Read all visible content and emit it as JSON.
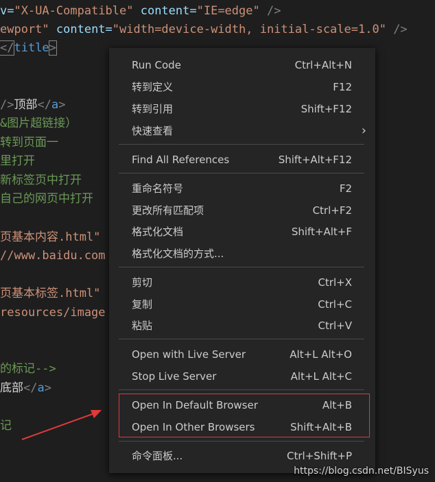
{
  "editor": {
    "line1": {
      "attr": "v=",
      "value": "\"X-UA-Compatible\"",
      "attr2": " content=",
      "value2": "\"IE=edge\"",
      "end": " />"
    },
    "line2": {
      "attr": "ewport\"",
      "attr2": " content=",
      "value2": "\"width=device-width, initial-scale=1.0\"",
      "end": " />"
    },
    "line3": {
      "open": "</",
      "tag": "title",
      "close": ">"
    },
    "line4": {
      "before": "/>",
      "text": "顶部",
      "open": "</",
      "tag": "a",
      "close": ">"
    },
    "line5": "&图片超链接）",
    "line6": "转到页面一",
    "line7": "里打开",
    "line8": "新标签页中打开",
    "line9": "自己的网页中打开",
    "line10": "页基本内容.html\"",
    "line11": "//www.baidu.com",
    "line12": "页基本标签.html\"",
    "line13": "resources/image",
    "line14": "的标记-->",
    "line15": {
      "text": "底部",
      "open": "</",
      "tag": "a",
      "close": ">"
    },
    "line16": "记"
  },
  "context_menu": {
    "items": [
      {
        "label": "Run Code",
        "shortcut": "Ctrl+Alt+N"
      },
      {
        "label": "转到定义",
        "shortcut": "F12"
      },
      {
        "label": "转到引用",
        "shortcut": "Shift+F12"
      },
      {
        "label": "快速查看",
        "shortcut": "",
        "submenu": true
      },
      {
        "label": "Find All References",
        "shortcut": "Shift+Alt+F12"
      },
      {
        "label": "重命名符号",
        "shortcut": "F2"
      },
      {
        "label": "更改所有匹配项",
        "shortcut": "Ctrl+F2"
      },
      {
        "label": "格式化文档",
        "shortcut": "Shift+Alt+F"
      },
      {
        "label": "格式化文档的方式...",
        "shortcut": ""
      },
      {
        "label": "剪切",
        "shortcut": "Ctrl+X"
      },
      {
        "label": "复制",
        "shortcut": "Ctrl+C"
      },
      {
        "label": "粘贴",
        "shortcut": "Ctrl+V"
      },
      {
        "label": "Open with Live Server",
        "shortcut": "Alt+L Alt+O"
      },
      {
        "label": "Stop Live Server",
        "shortcut": "Alt+L Alt+C"
      },
      {
        "label": "Open In Default Browser",
        "shortcut": "Alt+B"
      },
      {
        "label": "Open In Other Browsers",
        "shortcut": "Shift+Alt+B"
      },
      {
        "label": "命令面板...",
        "shortcut": "Ctrl+Shift+P"
      }
    ],
    "submenu_icon": "chevron-right-icon"
  },
  "annotation": {
    "highlight_color": "#e03a3a",
    "arrow_icon": "red-arrow"
  },
  "watermark": "https://blog.csdn.net/BISyus",
  "colors": {
    "background": "#1e1e1e",
    "menu_bg": "#252526",
    "menu_text": "#cccccc",
    "attr": "#9cdcfe",
    "string": "#ce9178",
    "tag": "#569cd6",
    "comment": "#6a9955"
  }
}
